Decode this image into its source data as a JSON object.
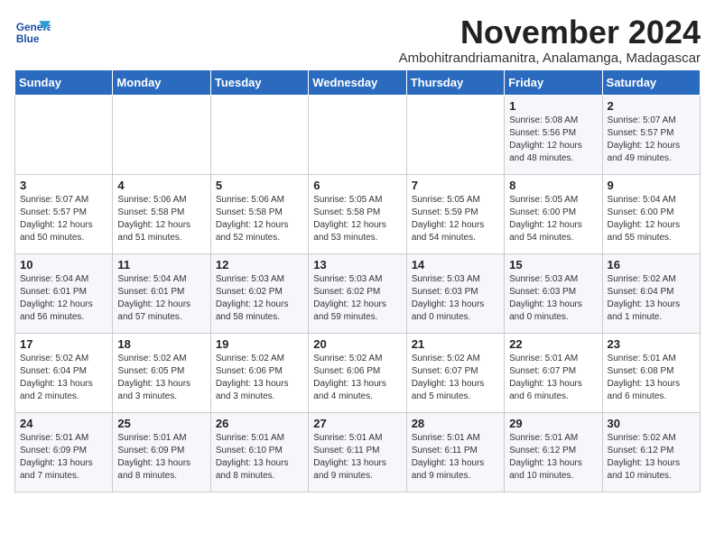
{
  "logo": {
    "line1": "General",
    "line2": "Blue"
  },
  "title": "November 2024",
  "subtitle": "Ambohitrandriamanitra, Analamanga, Madagascar",
  "headers": [
    "Sunday",
    "Monday",
    "Tuesday",
    "Wednesday",
    "Thursday",
    "Friday",
    "Saturday"
  ],
  "weeks": [
    [
      {
        "day": "",
        "info": ""
      },
      {
        "day": "",
        "info": ""
      },
      {
        "day": "",
        "info": ""
      },
      {
        "day": "",
        "info": ""
      },
      {
        "day": "",
        "info": ""
      },
      {
        "day": "1",
        "info": "Sunrise: 5:08 AM\nSunset: 5:56 PM\nDaylight: 12 hours\nand 48 minutes."
      },
      {
        "day": "2",
        "info": "Sunrise: 5:07 AM\nSunset: 5:57 PM\nDaylight: 12 hours\nand 49 minutes."
      }
    ],
    [
      {
        "day": "3",
        "info": "Sunrise: 5:07 AM\nSunset: 5:57 PM\nDaylight: 12 hours\nand 50 minutes."
      },
      {
        "day": "4",
        "info": "Sunrise: 5:06 AM\nSunset: 5:58 PM\nDaylight: 12 hours\nand 51 minutes."
      },
      {
        "day": "5",
        "info": "Sunrise: 5:06 AM\nSunset: 5:58 PM\nDaylight: 12 hours\nand 52 minutes."
      },
      {
        "day": "6",
        "info": "Sunrise: 5:05 AM\nSunset: 5:58 PM\nDaylight: 12 hours\nand 53 minutes."
      },
      {
        "day": "7",
        "info": "Sunrise: 5:05 AM\nSunset: 5:59 PM\nDaylight: 12 hours\nand 54 minutes."
      },
      {
        "day": "8",
        "info": "Sunrise: 5:05 AM\nSunset: 6:00 PM\nDaylight: 12 hours\nand 54 minutes."
      },
      {
        "day": "9",
        "info": "Sunrise: 5:04 AM\nSunset: 6:00 PM\nDaylight: 12 hours\nand 55 minutes."
      }
    ],
    [
      {
        "day": "10",
        "info": "Sunrise: 5:04 AM\nSunset: 6:01 PM\nDaylight: 12 hours\nand 56 minutes."
      },
      {
        "day": "11",
        "info": "Sunrise: 5:04 AM\nSunset: 6:01 PM\nDaylight: 12 hours\nand 57 minutes."
      },
      {
        "day": "12",
        "info": "Sunrise: 5:03 AM\nSunset: 6:02 PM\nDaylight: 12 hours\nand 58 minutes."
      },
      {
        "day": "13",
        "info": "Sunrise: 5:03 AM\nSunset: 6:02 PM\nDaylight: 12 hours\nand 59 minutes."
      },
      {
        "day": "14",
        "info": "Sunrise: 5:03 AM\nSunset: 6:03 PM\nDaylight: 13 hours\nand 0 minutes."
      },
      {
        "day": "15",
        "info": "Sunrise: 5:03 AM\nSunset: 6:03 PM\nDaylight: 13 hours\nand 0 minutes."
      },
      {
        "day": "16",
        "info": "Sunrise: 5:02 AM\nSunset: 6:04 PM\nDaylight: 13 hours\nand 1 minute."
      }
    ],
    [
      {
        "day": "17",
        "info": "Sunrise: 5:02 AM\nSunset: 6:04 PM\nDaylight: 13 hours\nand 2 minutes."
      },
      {
        "day": "18",
        "info": "Sunrise: 5:02 AM\nSunset: 6:05 PM\nDaylight: 13 hours\nand 3 minutes."
      },
      {
        "day": "19",
        "info": "Sunrise: 5:02 AM\nSunset: 6:06 PM\nDaylight: 13 hours\nand 3 minutes."
      },
      {
        "day": "20",
        "info": "Sunrise: 5:02 AM\nSunset: 6:06 PM\nDaylight: 13 hours\nand 4 minutes."
      },
      {
        "day": "21",
        "info": "Sunrise: 5:02 AM\nSunset: 6:07 PM\nDaylight: 13 hours\nand 5 minutes."
      },
      {
        "day": "22",
        "info": "Sunrise: 5:01 AM\nSunset: 6:07 PM\nDaylight: 13 hours\nand 6 minutes."
      },
      {
        "day": "23",
        "info": "Sunrise: 5:01 AM\nSunset: 6:08 PM\nDaylight: 13 hours\nand 6 minutes."
      }
    ],
    [
      {
        "day": "24",
        "info": "Sunrise: 5:01 AM\nSunset: 6:09 PM\nDaylight: 13 hours\nand 7 minutes."
      },
      {
        "day": "25",
        "info": "Sunrise: 5:01 AM\nSunset: 6:09 PM\nDaylight: 13 hours\nand 8 minutes."
      },
      {
        "day": "26",
        "info": "Sunrise: 5:01 AM\nSunset: 6:10 PM\nDaylight: 13 hours\nand 8 minutes."
      },
      {
        "day": "27",
        "info": "Sunrise: 5:01 AM\nSunset: 6:11 PM\nDaylight: 13 hours\nand 9 minutes."
      },
      {
        "day": "28",
        "info": "Sunrise: 5:01 AM\nSunset: 6:11 PM\nDaylight: 13 hours\nand 9 minutes."
      },
      {
        "day": "29",
        "info": "Sunrise: 5:01 AM\nSunset: 6:12 PM\nDaylight: 13 hours\nand 10 minutes."
      },
      {
        "day": "30",
        "info": "Sunrise: 5:02 AM\nSunset: 6:12 PM\nDaylight: 13 hours\nand 10 minutes."
      }
    ]
  ]
}
